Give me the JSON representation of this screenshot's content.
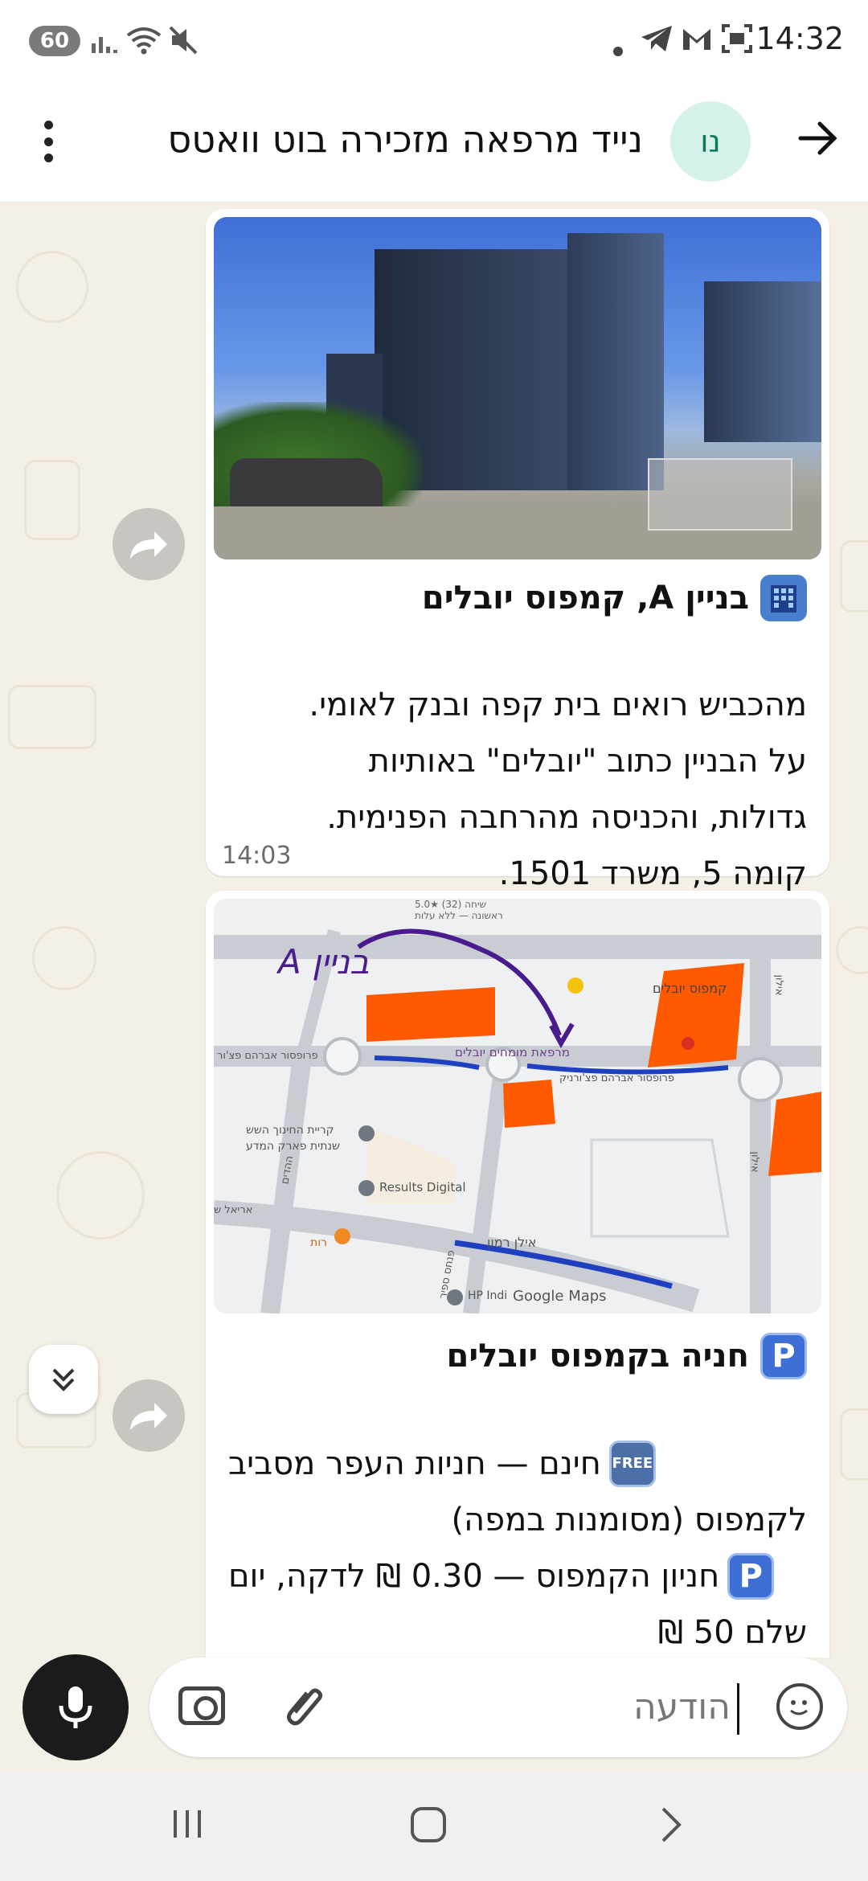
{
  "status_bar": {
    "battery": "60",
    "time": "14:32",
    "icons": [
      "signal-icon",
      "wifi-icon",
      "mute-icon",
      "dot-icon",
      "telegram-icon",
      "gmail-icon",
      "screenshot-icon"
    ]
  },
  "header": {
    "avatar_initials": "נו",
    "title": "נייד מרפאה מזכירה בוט וואטס"
  },
  "messages": [
    {
      "title": "בניין A, קמפוס יובלים",
      "body_lines": [
        "מהכביש רואים בית קפה ובנק לאומי.",
        "על הבניין כתוב \"יובלים\" באותיות",
        "גדולות, והכניסה מהרחבה הפנימית.",
        "קומה 5, משרד 1501."
      ],
      "time": "14:03"
    },
    {
      "title": "חניה בקמפוס יובלים",
      "free_badge": "FREE",
      "p_badge": "P",
      "line1": "חינם — חניות העפר מסביב",
      "line2": "לקמפוס (מסומנות במפה)",
      "line3": "חניון הקמפוס — 0.30 ₪ לדקה, יום",
      "line4": "שלם 50 ₪"
    }
  ],
  "map": {
    "labels": {
      "campus": "קמפוס יובלים",
      "clinic": "מרפאת מומחים יובלים",
      "street_top": "פרופסור אברהם פצ'ורניק",
      "street_left": "פרופסור אברהם פצ'ור",
      "school": "קריית החינוך השש",
      "school2": "שנתית פארק המדע",
      "results": "Results Digital",
      "ilan_ramon": "אילן רמון",
      "ariel": "אריאל ש",
      "rut": "רות",
      "hp": "HP Indi",
      "ilan": "אילון",
      "ilan2": "אילון",
      "hahadim": "ההדים",
      "pinas": "פנחס ספיר",
      "google": "Google Maps",
      "top_info": "שיחה (32) ★5.0",
      "top_info2": "ראשונה — ללא עלות",
      "annot": "בניין A"
    }
  },
  "composer": {
    "placeholder": "הודעה"
  },
  "colors": {
    "chat_bg": "#f4efe7",
    "bubble": "#ffffff",
    "accent_avatar": "#d4f2ea",
    "mic_button": "#1b1b1b",
    "parking_marker": "#ff5a00",
    "route_blue": "#1e3fbf"
  }
}
